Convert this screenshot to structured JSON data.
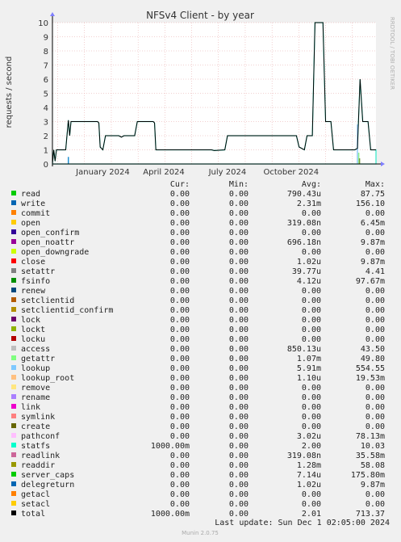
{
  "chart_data": {
    "type": "line",
    "title": "NFSv4 Client - by year",
    "ylabel": "requests / second",
    "watermark": "RRDTOOL / TOBI OETIKER",
    "ylim": [
      0,
      10
    ],
    "y_ticks": [
      "0",
      "1",
      "2",
      "3",
      "4",
      "5",
      "6",
      "7",
      "8",
      "9",
      "10"
    ],
    "x_ticks": [
      "January 2024",
      "April 2024",
      "July 2024",
      "October 2024"
    ],
    "grid": true,
    "background": "#ffffff",
    "grid_color": "#e5a0a0",
    "series_total": {
      "name": "total",
      "color": "#000000",
      "points": [
        [
          0,
          0
        ],
        [
          0.5,
          1
        ],
        [
          1,
          0.2
        ],
        [
          1.5,
          1
        ],
        [
          5,
          1
        ],
        [
          6,
          3.1
        ],
        [
          6.5,
          2
        ],
        [
          7,
          3
        ],
        [
          17,
          3
        ],
        [
          17.5,
          2.9
        ],
        [
          18,
          1.2
        ],
        [
          19,
          1
        ],
        [
          20,
          2
        ],
        [
          25,
          2
        ],
        [
          26,
          1.9
        ],
        [
          27,
          2
        ],
        [
          31,
          2
        ],
        [
          32,
          3
        ],
        [
          38,
          3
        ],
        [
          38.5,
          2.9
        ],
        [
          39,
          1
        ],
        [
          60,
          1
        ],
        [
          61,
          0.95
        ],
        [
          65,
          1
        ],
        [
          66,
          2
        ],
        [
          92,
          2
        ],
        [
          93,
          1.2
        ],
        [
          95,
          1
        ],
        [
          96,
          2
        ],
        [
          98,
          2
        ],
        [
          99,
          10
        ],
        [
          102,
          10
        ],
        [
          103,
          3
        ],
        [
          105,
          3
        ],
        [
          106,
          1
        ],
        [
          114,
          1
        ],
        [
          115,
          1.1
        ],
        [
          116,
          6
        ],
        [
          117,
          3
        ],
        [
          118,
          3
        ],
        [
          119,
          3
        ],
        [
          120,
          1
        ],
        [
          122,
          1
        ]
      ]
    },
    "series_statfs": {
      "name": "statfs",
      "color": "#2ee8c8",
      "points": [
        [
          0,
          0
        ],
        [
          0.5,
          1
        ],
        [
          1,
          0.2
        ],
        [
          1.5,
          1
        ],
        [
          5,
          1
        ],
        [
          6,
          3.1
        ],
        [
          6.5,
          2
        ],
        [
          7,
          3
        ],
        [
          17,
          3
        ],
        [
          17.5,
          2.9
        ],
        [
          18,
          1.2
        ],
        [
          19,
          1
        ],
        [
          20,
          2
        ],
        [
          25,
          2
        ],
        [
          26,
          1.9
        ],
        [
          27,
          2
        ],
        [
          31,
          2
        ],
        [
          32,
          3
        ],
        [
          38,
          3
        ],
        [
          38.5,
          2.9
        ],
        [
          39,
          1
        ],
        [
          60,
          1
        ],
        [
          61,
          0.95
        ],
        [
          65,
          1
        ],
        [
          66,
          2
        ],
        [
          92,
          2
        ],
        [
          93,
          1.2
        ],
        [
          95,
          1
        ],
        [
          96,
          2
        ],
        [
          98,
          2
        ],
        [
          99,
          10
        ],
        [
          102,
          10
        ],
        [
          103,
          3
        ],
        [
          105,
          3
        ],
        [
          106,
          1
        ],
        [
          114,
          1
        ],
        [
          115,
          1.1
        ],
        [
          116,
          6
        ],
        [
          117,
          3
        ],
        [
          118,
          3
        ],
        [
          119,
          3
        ],
        [
          120,
          1
        ],
        [
          122,
          1
        ]
      ]
    },
    "spikes": [
      {
        "name": "lookup",
        "color": "#8fc7f8",
        "x": 115,
        "y": 2.8
      },
      {
        "name": "getattr",
        "color": "#8ef08e",
        "x": 115.5,
        "y": 0.8
      },
      {
        "name": "setattr",
        "color": "#7a9a3a",
        "x": 115.8,
        "y": 0.4
      },
      {
        "name": "write",
        "color": "#2090d0",
        "x": 6,
        "y": 0.5
      }
    ],
    "table_header": {
      "cur": "Cur:",
      "min": "Min:",
      "avg": "Avg:",
      "max": "Max:"
    },
    "legend": [
      {
        "name": "read",
        "color": "#00cc00",
        "cur": "0.00",
        "min": "0.00",
        "avg": "790.43u",
        "max": "87.75"
      },
      {
        "name": "write",
        "color": "#0066b3",
        "cur": "0.00",
        "min": "0.00",
        "avg": "2.31m",
        "max": "156.10"
      },
      {
        "name": "commit",
        "color": "#ff8000",
        "cur": "0.00",
        "min": "0.00",
        "avg": "0.00",
        "max": "0.00"
      },
      {
        "name": "open",
        "color": "#ffcc00",
        "cur": "0.00",
        "min": "0.00",
        "avg": "319.08n",
        "max": "6.45m"
      },
      {
        "name": "open_confirm",
        "color": "#330099",
        "cur": "0.00",
        "min": "0.00",
        "avg": "0.00",
        "max": "0.00"
      },
      {
        "name": "open_noattr",
        "color": "#990099",
        "cur": "0.00",
        "min": "0.00",
        "avg": "696.18n",
        "max": "9.87m"
      },
      {
        "name": "open_downgrade",
        "color": "#ccff00",
        "cur": "0.00",
        "min": "0.00",
        "avg": "0.00",
        "max": "0.00"
      },
      {
        "name": "close",
        "color": "#ff0000",
        "cur": "0.00",
        "min": "0.00",
        "avg": "1.02u",
        "max": "9.87m"
      },
      {
        "name": "setattr",
        "color": "#808080",
        "cur": "0.00",
        "min": "0.00",
        "avg": "39.77u",
        "max": "4.41"
      },
      {
        "name": "fsinfo",
        "color": "#008f00",
        "cur": "0.00",
        "min": "0.00",
        "avg": "4.12u",
        "max": "97.67m"
      },
      {
        "name": "renew",
        "color": "#00487d",
        "cur": "0.00",
        "min": "0.00",
        "avg": "0.00",
        "max": "0.00"
      },
      {
        "name": "setclientid",
        "color": "#b35a00",
        "cur": "0.00",
        "min": "0.00",
        "avg": "0.00",
        "max": "0.00"
      },
      {
        "name": "setclientid_confirm",
        "color": "#b38f00",
        "cur": "0.00",
        "min": "0.00",
        "avg": "0.00",
        "max": "0.00"
      },
      {
        "name": "lock",
        "color": "#6b006b",
        "cur": "0.00",
        "min": "0.00",
        "avg": "0.00",
        "max": "0.00"
      },
      {
        "name": "lockt",
        "color": "#8fb300",
        "cur": "0.00",
        "min": "0.00",
        "avg": "0.00",
        "max": "0.00"
      },
      {
        "name": "locku",
        "color": "#b30000",
        "cur": "0.00",
        "min": "0.00",
        "avg": "0.00",
        "max": "0.00"
      },
      {
        "name": "access",
        "color": "#bebebe",
        "cur": "0.00",
        "min": "0.00",
        "avg": "850.13u",
        "max": "43.50"
      },
      {
        "name": "getattr",
        "color": "#80ff80",
        "cur": "0.00",
        "min": "0.00",
        "avg": "1.07m",
        "max": "49.80"
      },
      {
        "name": "lookup",
        "color": "#80c9ff",
        "cur": "0.00",
        "min": "0.00",
        "avg": "5.91m",
        "max": "554.55"
      },
      {
        "name": "lookup_root",
        "color": "#ffc080",
        "cur": "0.00",
        "min": "0.00",
        "avg": "1.10u",
        "max": "19.53m"
      },
      {
        "name": "remove",
        "color": "#ffe680",
        "cur": "0.00",
        "min": "0.00",
        "avg": "0.00",
        "max": "0.00"
      },
      {
        "name": "rename",
        "color": "#aa80ff",
        "cur": "0.00",
        "min": "0.00",
        "avg": "0.00",
        "max": "0.00"
      },
      {
        "name": "link",
        "color": "#ee00cc",
        "cur": "0.00",
        "min": "0.00",
        "avg": "0.00",
        "max": "0.00"
      },
      {
        "name": "symlink",
        "color": "#ff8080",
        "cur": "0.00",
        "min": "0.00",
        "avg": "0.00",
        "max": "0.00"
      },
      {
        "name": "create",
        "color": "#666600",
        "cur": "0.00",
        "min": "0.00",
        "avg": "0.00",
        "max": "0.00"
      },
      {
        "name": "pathconf",
        "color": "#ffbfff",
        "cur": "0.00",
        "min": "0.00",
        "avg": "3.02u",
        "max": "78.13m"
      },
      {
        "name": "statfs",
        "color": "#00ffcc",
        "cur": "1000.00m",
        "min": "0.00",
        "avg": "2.00",
        "max": "10.03"
      },
      {
        "name": "readlink",
        "color": "#cc6699",
        "cur": "0.00",
        "min": "0.00",
        "avg": "319.08n",
        "max": "35.58m"
      },
      {
        "name": "readdir",
        "color": "#999900",
        "cur": "0.00",
        "min": "0.00",
        "avg": "1.28m",
        "max": "58.08"
      },
      {
        "name": "server_caps",
        "color": "#00cc00",
        "cur": "0.00",
        "min": "0.00",
        "avg": "7.14u",
        "max": "175.80m"
      },
      {
        "name": "delegreturn",
        "color": "#0066b3",
        "cur": "0.00",
        "min": "0.00",
        "avg": "1.02u",
        "max": "9.87m"
      },
      {
        "name": "getacl",
        "color": "#ff8000",
        "cur": "0.00",
        "min": "0.00",
        "avg": "0.00",
        "max": "0.00"
      },
      {
        "name": "setacl",
        "color": "#ffcc00",
        "cur": "0.00",
        "min": "0.00",
        "avg": "0.00",
        "max": "0.00"
      },
      {
        "name": "total",
        "color": "#000000",
        "cur": "1000.00m",
        "min": "0.00",
        "avg": "2.01",
        "max": "713.37"
      }
    ],
    "last_update": "Last update: Sun Dec  1 02:05:00 2024",
    "footer": "Munin 2.0.75"
  }
}
